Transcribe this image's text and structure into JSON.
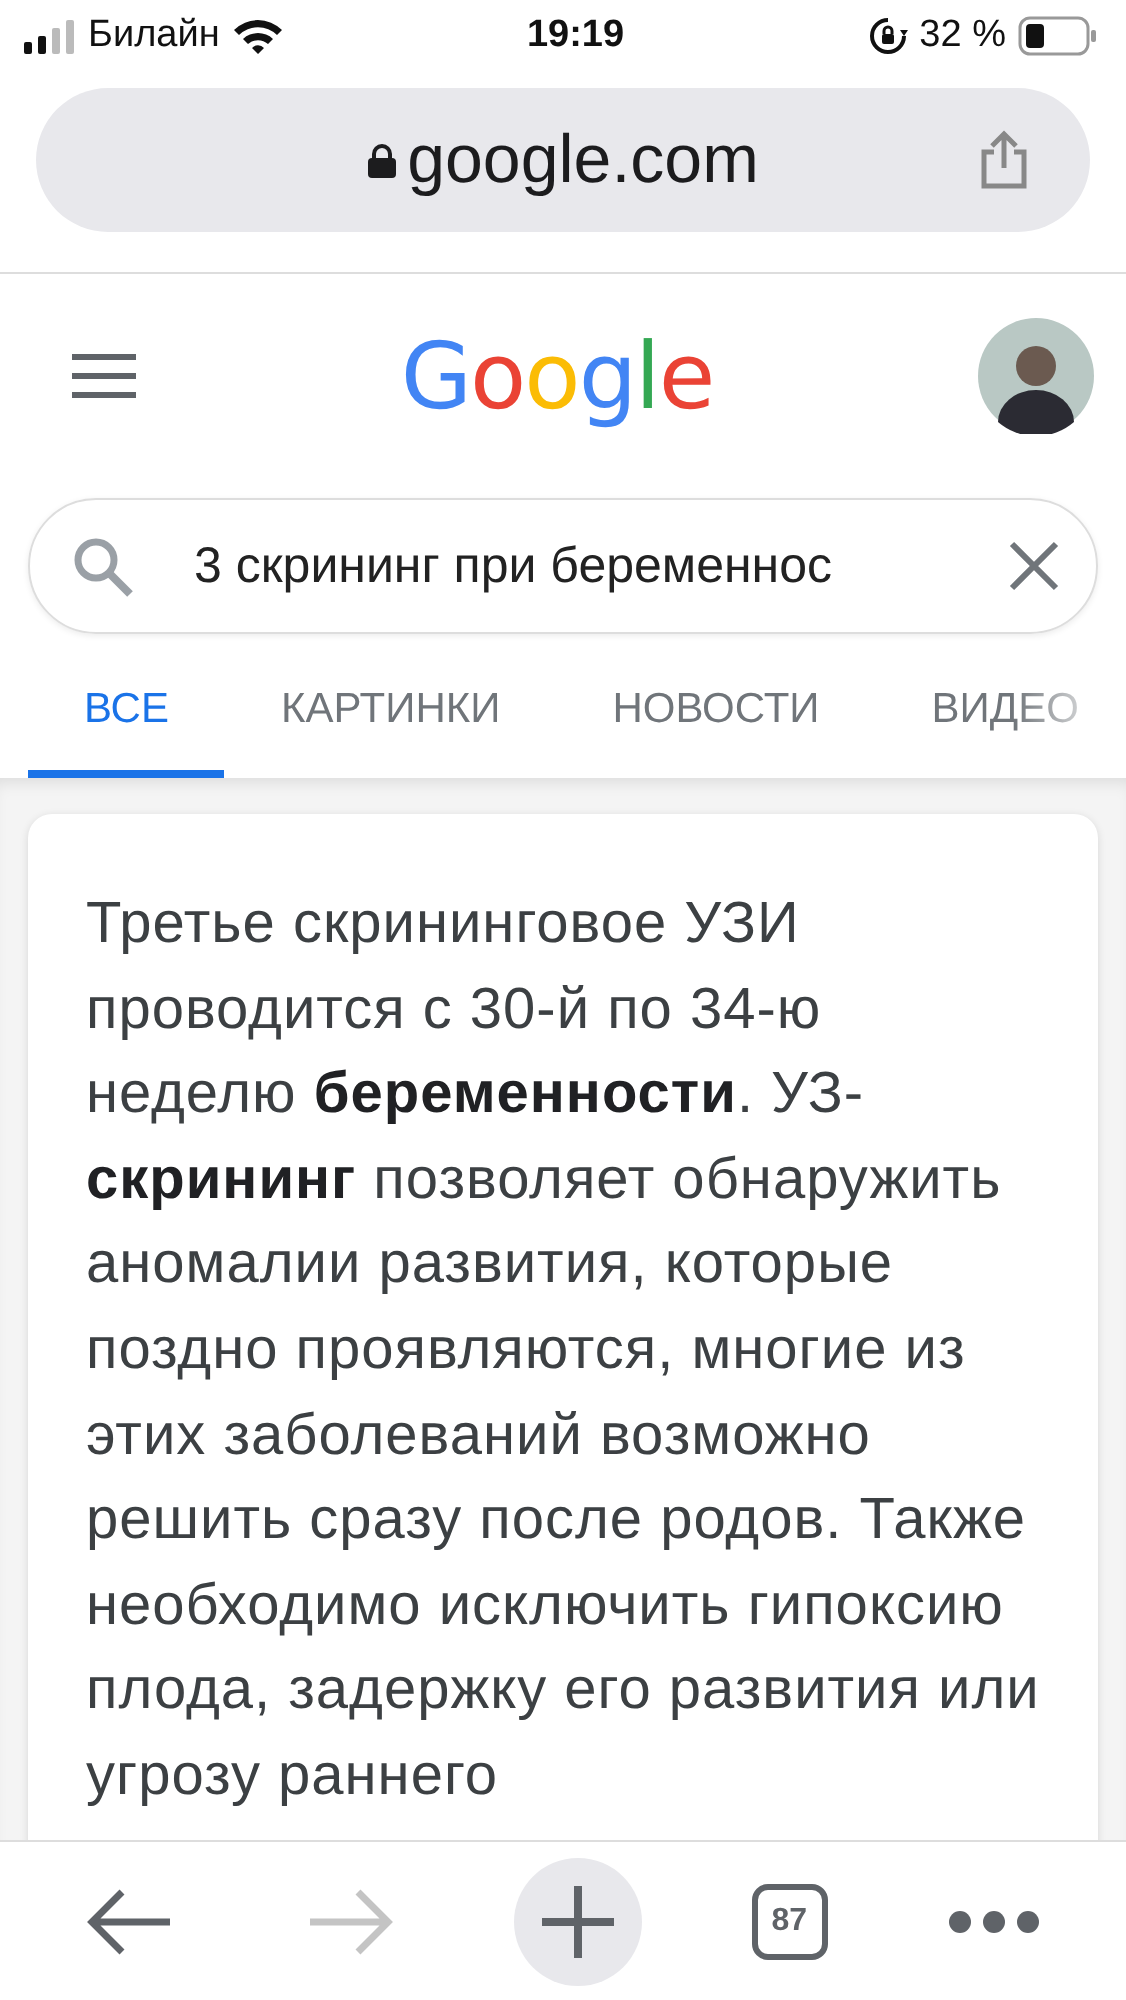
{
  "status_bar": {
    "carrier": "Билайн",
    "time": "19:19",
    "battery": "32 %"
  },
  "address_bar": {
    "url": "google.com"
  },
  "header": {
    "logo": "Google"
  },
  "search": {
    "value": "3 скрининг при беременнос"
  },
  "tabs": [
    {
      "label": "ВСЕ",
      "selected": true
    },
    {
      "label": "КАРТИНКИ",
      "selected": false
    },
    {
      "label": "НОВОСТИ",
      "selected": false
    },
    {
      "label": "ВИДЕО",
      "selected": false
    }
  ],
  "snippet": {
    "text": "Третье скрининговое УЗИ проводится с 30-й по 34-ю неделю **беременности**. УЗ-**скрининг** позволяет обнаружить аномалии развития, которые поздно проявляются, многие из этих заболеваний возможно решить сразу после родов. Также необходимо исключить гипоксию плода, задержку его развития или угрозу раннего"
  },
  "toolbar": {
    "back_disabled": false,
    "forward_disabled": true,
    "tab_count": "87"
  }
}
